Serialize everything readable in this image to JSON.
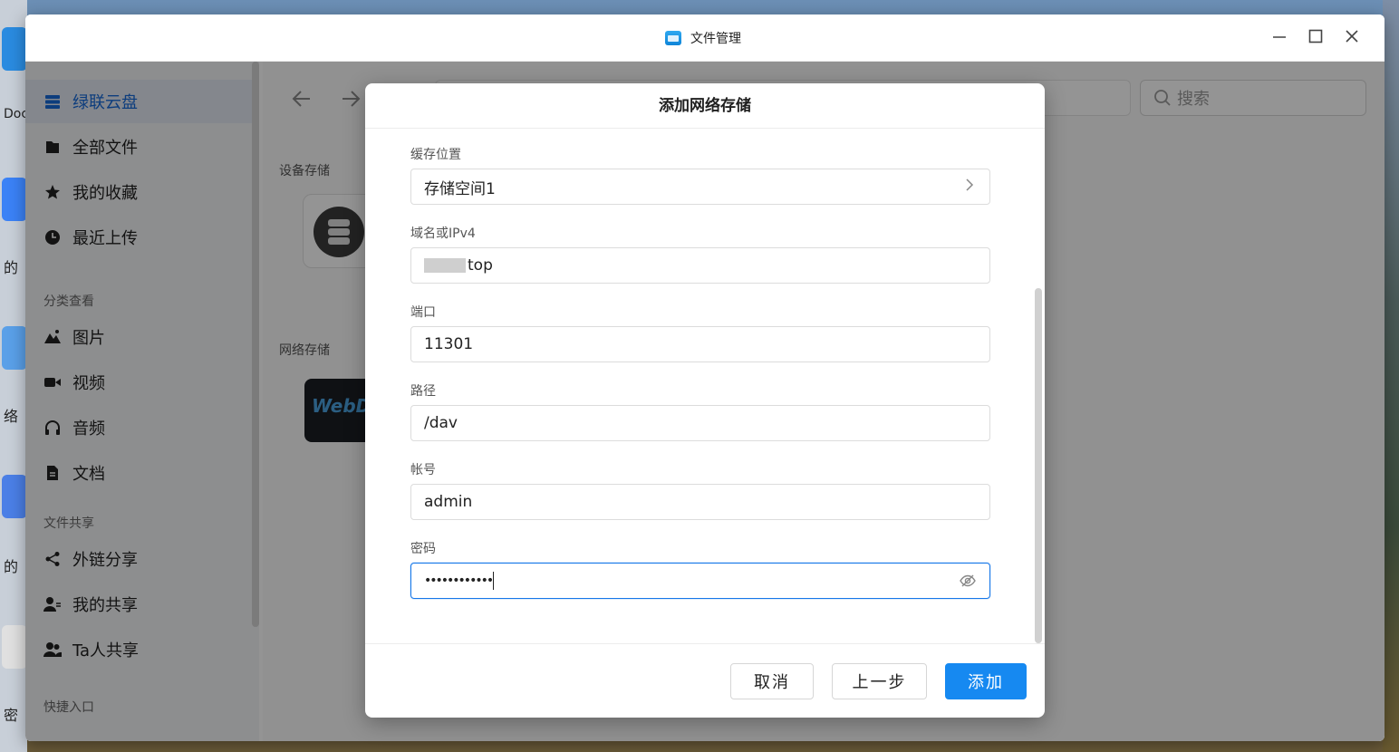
{
  "desktop": {
    "labels": [
      "Doc",
      "的",
      "络",
      "的",
      "密"
    ]
  },
  "window": {
    "title": "文件管理",
    "controls": [
      "minimize",
      "maximize",
      "close"
    ]
  },
  "sidebar": {
    "items": [
      {
        "label": "绿联云盘",
        "icon": "storage-icon",
        "active": true
      },
      {
        "label": "全部文件",
        "icon": "folder-icon"
      },
      {
        "label": "我的收藏",
        "icon": "star-icon"
      },
      {
        "label": "最近上传",
        "icon": "clock-icon"
      }
    ],
    "section_category": "分类查看",
    "category_items": [
      {
        "label": "图片",
        "icon": "image-icon"
      },
      {
        "label": "视频",
        "icon": "video-icon"
      },
      {
        "label": "音频",
        "icon": "headphones-icon"
      },
      {
        "label": "文档",
        "icon": "document-icon"
      }
    ],
    "section_share": "文件共享",
    "share_items": [
      {
        "label": "外链分享",
        "icon": "share-icon"
      },
      {
        "label": "我的共享",
        "icon": "user-share-icon"
      },
      {
        "label": "Ta人共享",
        "icon": "users-icon"
      }
    ],
    "section_quick": "快捷入口"
  },
  "main": {
    "search_placeholder": "搜索",
    "section_device": "设备存储",
    "section_network": "网络存储",
    "webdav_label": "WebDAV"
  },
  "dialog": {
    "title": "添加网络存储",
    "cache_label": "缓存位置",
    "cache_value": "存储空间1",
    "host_label": "域名或IPv4",
    "host_value": "top",
    "port_label": "端口",
    "port_value": "11301",
    "path_label": "路径",
    "path_value": "/dav",
    "account_label": "帐号",
    "account_value": "admin",
    "password_label": "密码",
    "password_value": "••••••••••••",
    "cancel": "取消",
    "prev": "上一步",
    "add": "添加"
  }
}
